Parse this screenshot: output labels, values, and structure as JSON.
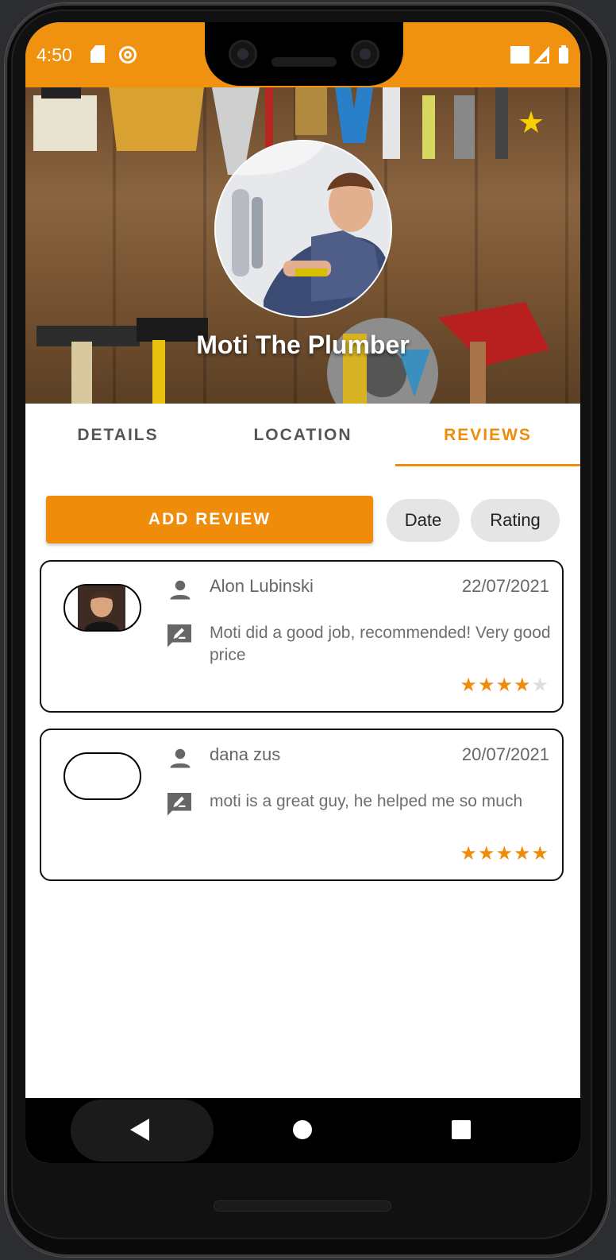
{
  "status_bar": {
    "time": "4:50"
  },
  "provider": {
    "name": "Moti The Plumber"
  },
  "tabs": [
    {
      "label": "DETAILS"
    },
    {
      "label": "LOCATION"
    },
    {
      "label": "REVIEWS"
    }
  ],
  "actions": {
    "add_review_label": "ADD REVIEW"
  },
  "sort_chips": [
    {
      "label": "Date"
    },
    {
      "label": "Rating"
    }
  ],
  "reviews": [
    {
      "name": "Alon Lubinski",
      "date": "22/07/2021",
      "text": "Moti did a good job, recommended! Very good price",
      "rating": 4,
      "max_rating": 5
    },
    {
      "name": "dana zus",
      "date": "20/07/2021",
      "text": "moti is a great guy, he helped me so much",
      "rating": 5,
      "max_rating": 5
    }
  ],
  "colors": {
    "accent": "#ef8c0a",
    "status_bar": "#f0920f",
    "favorite_star": "#f6d000"
  }
}
